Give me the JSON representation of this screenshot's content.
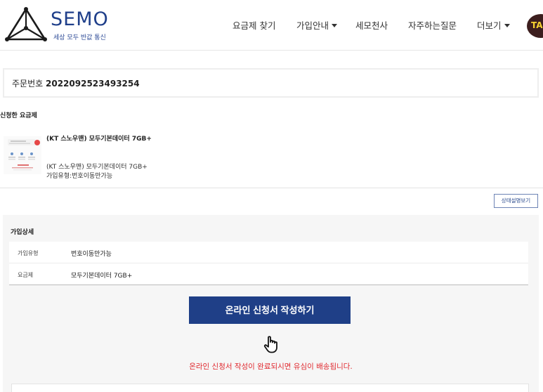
{
  "brand": {
    "name": "SEMO",
    "tagline": "세상 모두 반값 통신"
  },
  "nav": {
    "items": [
      {
        "label": "요금제 찾기"
      },
      {
        "label": "가입안내"
      },
      {
        "label": "세모천사"
      },
      {
        "label": "자주하는질문"
      },
      {
        "label": "더보기"
      }
    ],
    "talk_badge": "TAL"
  },
  "order": {
    "label": "주문번호",
    "number": "2022092523493254"
  },
  "section": {
    "applied_plan_title": "신청한 요금제"
  },
  "plan": {
    "name_bold": "(KT 스노우맨) 모두기본데이터 7GB+",
    "name": "(KT 스노우맨) 모두기본데이터 7GB+",
    "type": "가입유형:번호이동만가능"
  },
  "status_button": "상태설명보기",
  "detail": {
    "title": "가입상세",
    "rows": [
      {
        "key": "가입유형",
        "value": "번호이동만가능"
      },
      {
        "key": "요금제",
        "value": "모두기본데이터 7GB+"
      }
    ]
  },
  "apply_button": "온라인 신청서 작성하기",
  "notice": "온라인 신청서 작성이 완료되시면 유심이 배송됩니다.",
  "colors": {
    "brand_navy": "#1f3f87",
    "notice_red": "#e0282e"
  }
}
